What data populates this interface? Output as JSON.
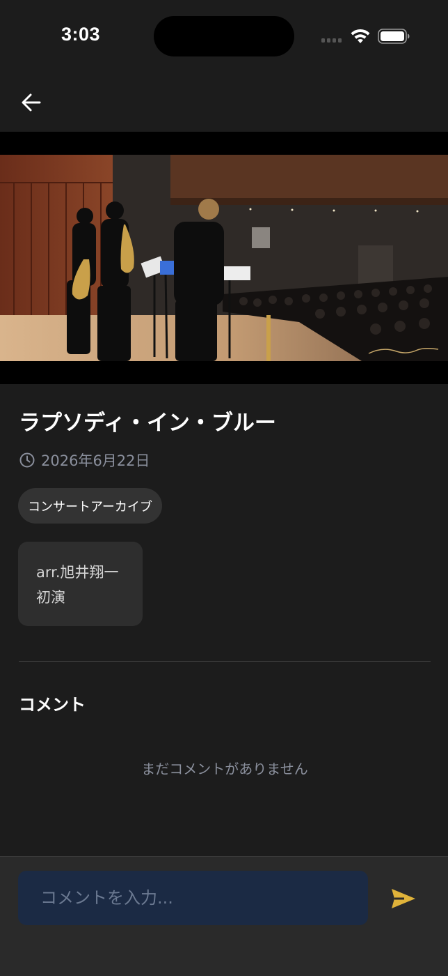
{
  "status_bar": {
    "time": "3:03"
  },
  "nav": {
    "back_icon": "arrow-left-icon"
  },
  "video": {
    "description_icon": "video-thumbnail"
  },
  "post": {
    "title": "ラプソディ・イン・ブルー",
    "date": "2026年6月22日",
    "tag": "コンサートアーカイブ",
    "note_lines": [
      "arr.旭井翔一",
      "初演"
    ]
  },
  "comments": {
    "heading": "コメント",
    "empty_message": "まだコメントがありません"
  },
  "composer": {
    "placeholder": "コメントを入力...",
    "input_value": ""
  },
  "colors": {
    "background": "#1c1c1c",
    "muted_text": "#8a8f9c",
    "input_bg": "#1b2a44",
    "send_accent": "#e0b33a"
  }
}
